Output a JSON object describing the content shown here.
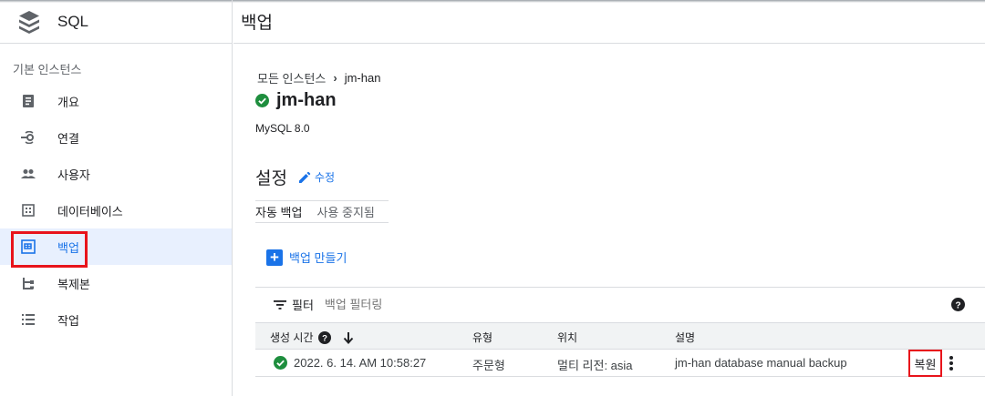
{
  "sidebar": {
    "product": "SQL",
    "section_title": "기본 인스턴스",
    "items": [
      {
        "label": "개요",
        "icon": "overview-icon"
      },
      {
        "label": "연결",
        "icon": "connections-icon"
      },
      {
        "label": "사용자",
        "icon": "users-icon"
      },
      {
        "label": "데이터베이스",
        "icon": "databases-icon"
      },
      {
        "label": "백업",
        "icon": "backups-icon",
        "active": true
      },
      {
        "label": "복제본",
        "icon": "replicas-icon"
      },
      {
        "label": "작업",
        "icon": "operations-icon"
      }
    ]
  },
  "header": {
    "title": "백업"
  },
  "breadcrumb": {
    "root": "모든 인스턴스",
    "current": "jm-han"
  },
  "instance": {
    "name": "jm-han",
    "status": "running",
    "version": "MySQL 8.0"
  },
  "settings": {
    "title": "설정",
    "edit_label": "수정",
    "auto_backup_label": "자동 백업",
    "auto_backup_value": "사용 중지됨"
  },
  "create_backup_label": "백업 만들기",
  "filter": {
    "label": "필터",
    "placeholder": "백업 필터링"
  },
  "table": {
    "columns": [
      "생성 시간",
      "유형",
      "위치",
      "설명"
    ],
    "rows": [
      {
        "created": "2022. 6. 14. AM 10:58:27",
        "type": "주문형",
        "location": "멀티 리전: asia",
        "description": "jm-han database manual backup",
        "action": "복원"
      }
    ]
  },
  "colors": {
    "accent": "#1a73e8",
    "success": "#1e8e3e",
    "highlight": "#e8141b"
  }
}
